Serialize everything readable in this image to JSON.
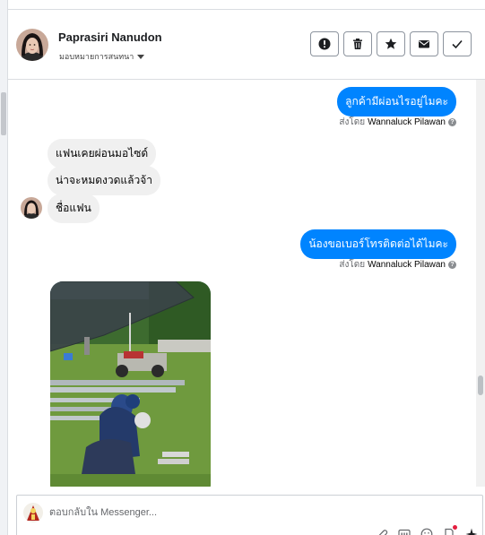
{
  "contact": {
    "name": "Paprasiri Nanudon",
    "assign_label": "มอบหมายการสนทนา"
  },
  "header_actions": [
    {
      "name": "mark-spam-button",
      "icon": "alert-icon"
    },
    {
      "name": "delete-button",
      "icon": "trash-icon"
    },
    {
      "name": "star-button",
      "icon": "star-icon"
    },
    {
      "name": "mark-unread-button",
      "icon": "envelope-icon"
    },
    {
      "name": "mark-done-button",
      "icon": "check-icon"
    }
  ],
  "messages": [
    {
      "type": "outgoing",
      "text": "ลูกค้ามีผ่อนไรอยู่ไมคะ",
      "sent_by_prefix": "ส่งโดย",
      "sent_by_name": "Wannaluck Pilawan"
    },
    {
      "type": "incoming",
      "text": "แฟนเคยผ่อนมอไซด์"
    },
    {
      "type": "incoming",
      "text": "น่าจะหมดงวดแล้วจ้า"
    },
    {
      "type": "incoming",
      "text": "ชื่อแฟน"
    },
    {
      "type": "outgoing",
      "text": "น้องขอเบอร์โทรติดต่อได้ไมคะ",
      "sent_by_prefix": "ส่งโดย",
      "sent_by_name": "Wannaluck Pilawan"
    },
    {
      "type": "incoming_image",
      "icon": "photo-image"
    }
  ],
  "help_icon": "?",
  "composer": {
    "placeholder": "ตอบกลับใน Messenger...",
    "value": "",
    "tools": [
      "attachment-icon",
      "gif-icon",
      "emoji-icon",
      "saved-reply-icon",
      "sparkle-icon"
    ]
  },
  "colors": {
    "outgoing_bubble": "#0084ff",
    "incoming_bubble": "#f0f0f0",
    "notification_dot": "#e41e3f"
  }
}
